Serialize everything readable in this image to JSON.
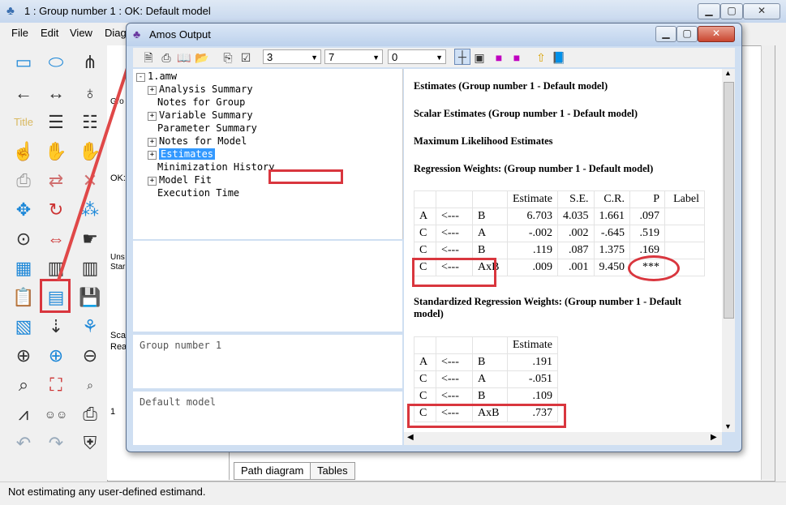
{
  "main": {
    "title": "1 : Group number 1 : OK: Default model",
    "menu": [
      "File",
      "Edit",
      "View",
      "Diag"
    ],
    "canvas_fragments": [
      "Gro",
      "OK:",
      "Uns",
      "Star",
      "Sca",
      "Rea",
      "1"
    ],
    "tabs": [
      "Path diagram",
      "Tables"
    ],
    "status": "Not estimating any user-defined estimand."
  },
  "output": {
    "title": "Amos Output",
    "toolbar": {
      "decimals": "3",
      "table_width": "7",
      "rows": "0"
    },
    "tree": [
      {
        "label": "1.amw",
        "indent": 0,
        "expander": "-"
      },
      {
        "label": "Analysis Summary",
        "indent": 1,
        "expander": "+"
      },
      {
        "label": "Notes for Group",
        "indent": 1,
        "expander": ""
      },
      {
        "label": "Variable Summary",
        "indent": 1,
        "expander": "+"
      },
      {
        "label": "Parameter Summary",
        "indent": 1,
        "expander": ""
      },
      {
        "label": "Notes for Model",
        "indent": 1,
        "expander": "+"
      },
      {
        "label": "Estimates",
        "indent": 1,
        "expander": "+",
        "selected": true
      },
      {
        "label": "Minimization History",
        "indent": 1,
        "expander": ""
      },
      {
        "label": "Model Fit",
        "indent": 1,
        "expander": "+"
      },
      {
        "label": "Execution Time",
        "indent": 1,
        "expander": ""
      }
    ],
    "group_label": "Group number 1",
    "model_label": "Default model",
    "headings": {
      "estimates": "Estimates (Group number 1 - Default model)",
      "scalar": "Scalar Estimates (Group number 1 - Default model)",
      "ml": "Maximum Likelihood Estimates",
      "regression": "Regression Weights: (Group number 1 - Default model)",
      "standardized": "Standardized Regression Weights: (Group number 1 - Default model)"
    },
    "regression_table": {
      "columns": [
        "",
        "",
        "",
        "Estimate",
        "S.E.",
        "C.R.",
        "P",
        "Label"
      ],
      "rows": [
        [
          "A",
          "<---",
          "B",
          "6.703",
          "4.035",
          "1.661",
          ".097",
          ""
        ],
        [
          "C",
          "<---",
          "A",
          "-.002",
          ".002",
          "-.645",
          ".519",
          ""
        ],
        [
          "C",
          "<---",
          "B",
          ".119",
          ".087",
          "1.375",
          ".169",
          ""
        ],
        [
          "C",
          "<---",
          "AxB",
          ".009",
          ".001",
          "9.450",
          "***",
          ""
        ]
      ]
    },
    "std_table": {
      "columns": [
        "",
        "",
        "",
        "Estimate"
      ],
      "rows": [
        [
          "A",
          "<---",
          "B",
          ".191"
        ],
        [
          "C",
          "<---",
          "A",
          "-.051"
        ],
        [
          "C",
          "<---",
          "B",
          ".109"
        ],
        [
          "C",
          "<---",
          "AxB",
          ".737"
        ]
      ]
    }
  }
}
